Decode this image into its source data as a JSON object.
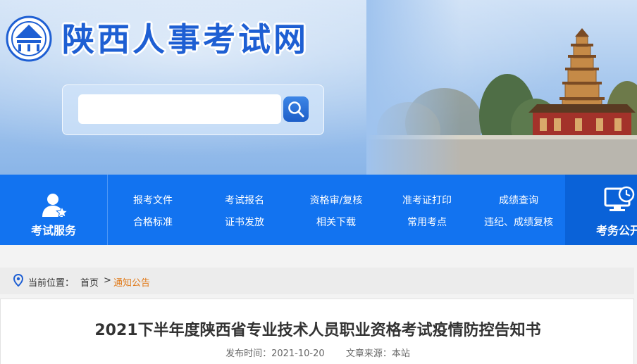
{
  "header": {
    "site_title": "陕西人事考试网",
    "search": {
      "placeholder": "",
      "button_icon": "search-icon"
    }
  },
  "nav": {
    "service": {
      "label": "考试服务",
      "icon": "user-star-icon"
    },
    "links": [
      "报考文件",
      "考试报名",
      "资格审/复核",
      "准考证打印",
      "成绩查询",
      "合格标准",
      "证书发放",
      "相关下载",
      "常用考点",
      "违纪、成绩复核"
    ],
    "public": {
      "label": "考务公开",
      "icon": "monitor-clock-icon"
    }
  },
  "breadcrumb": {
    "prefix": "当前位置：",
    "home": "首页",
    "separator": ">",
    "current": "通知公告"
  },
  "article": {
    "title": "2021下半年度陕西省专业技术人员职业资格考试疫情防控告知书",
    "publish_time": "发布时间：2021-10-20",
    "source": "文章来源：本站"
  },
  "colors": {
    "nav_blue": "#1273f0",
    "title_blue": "#1e5fd3",
    "breadcrumb_active": "#e07a1a"
  }
}
